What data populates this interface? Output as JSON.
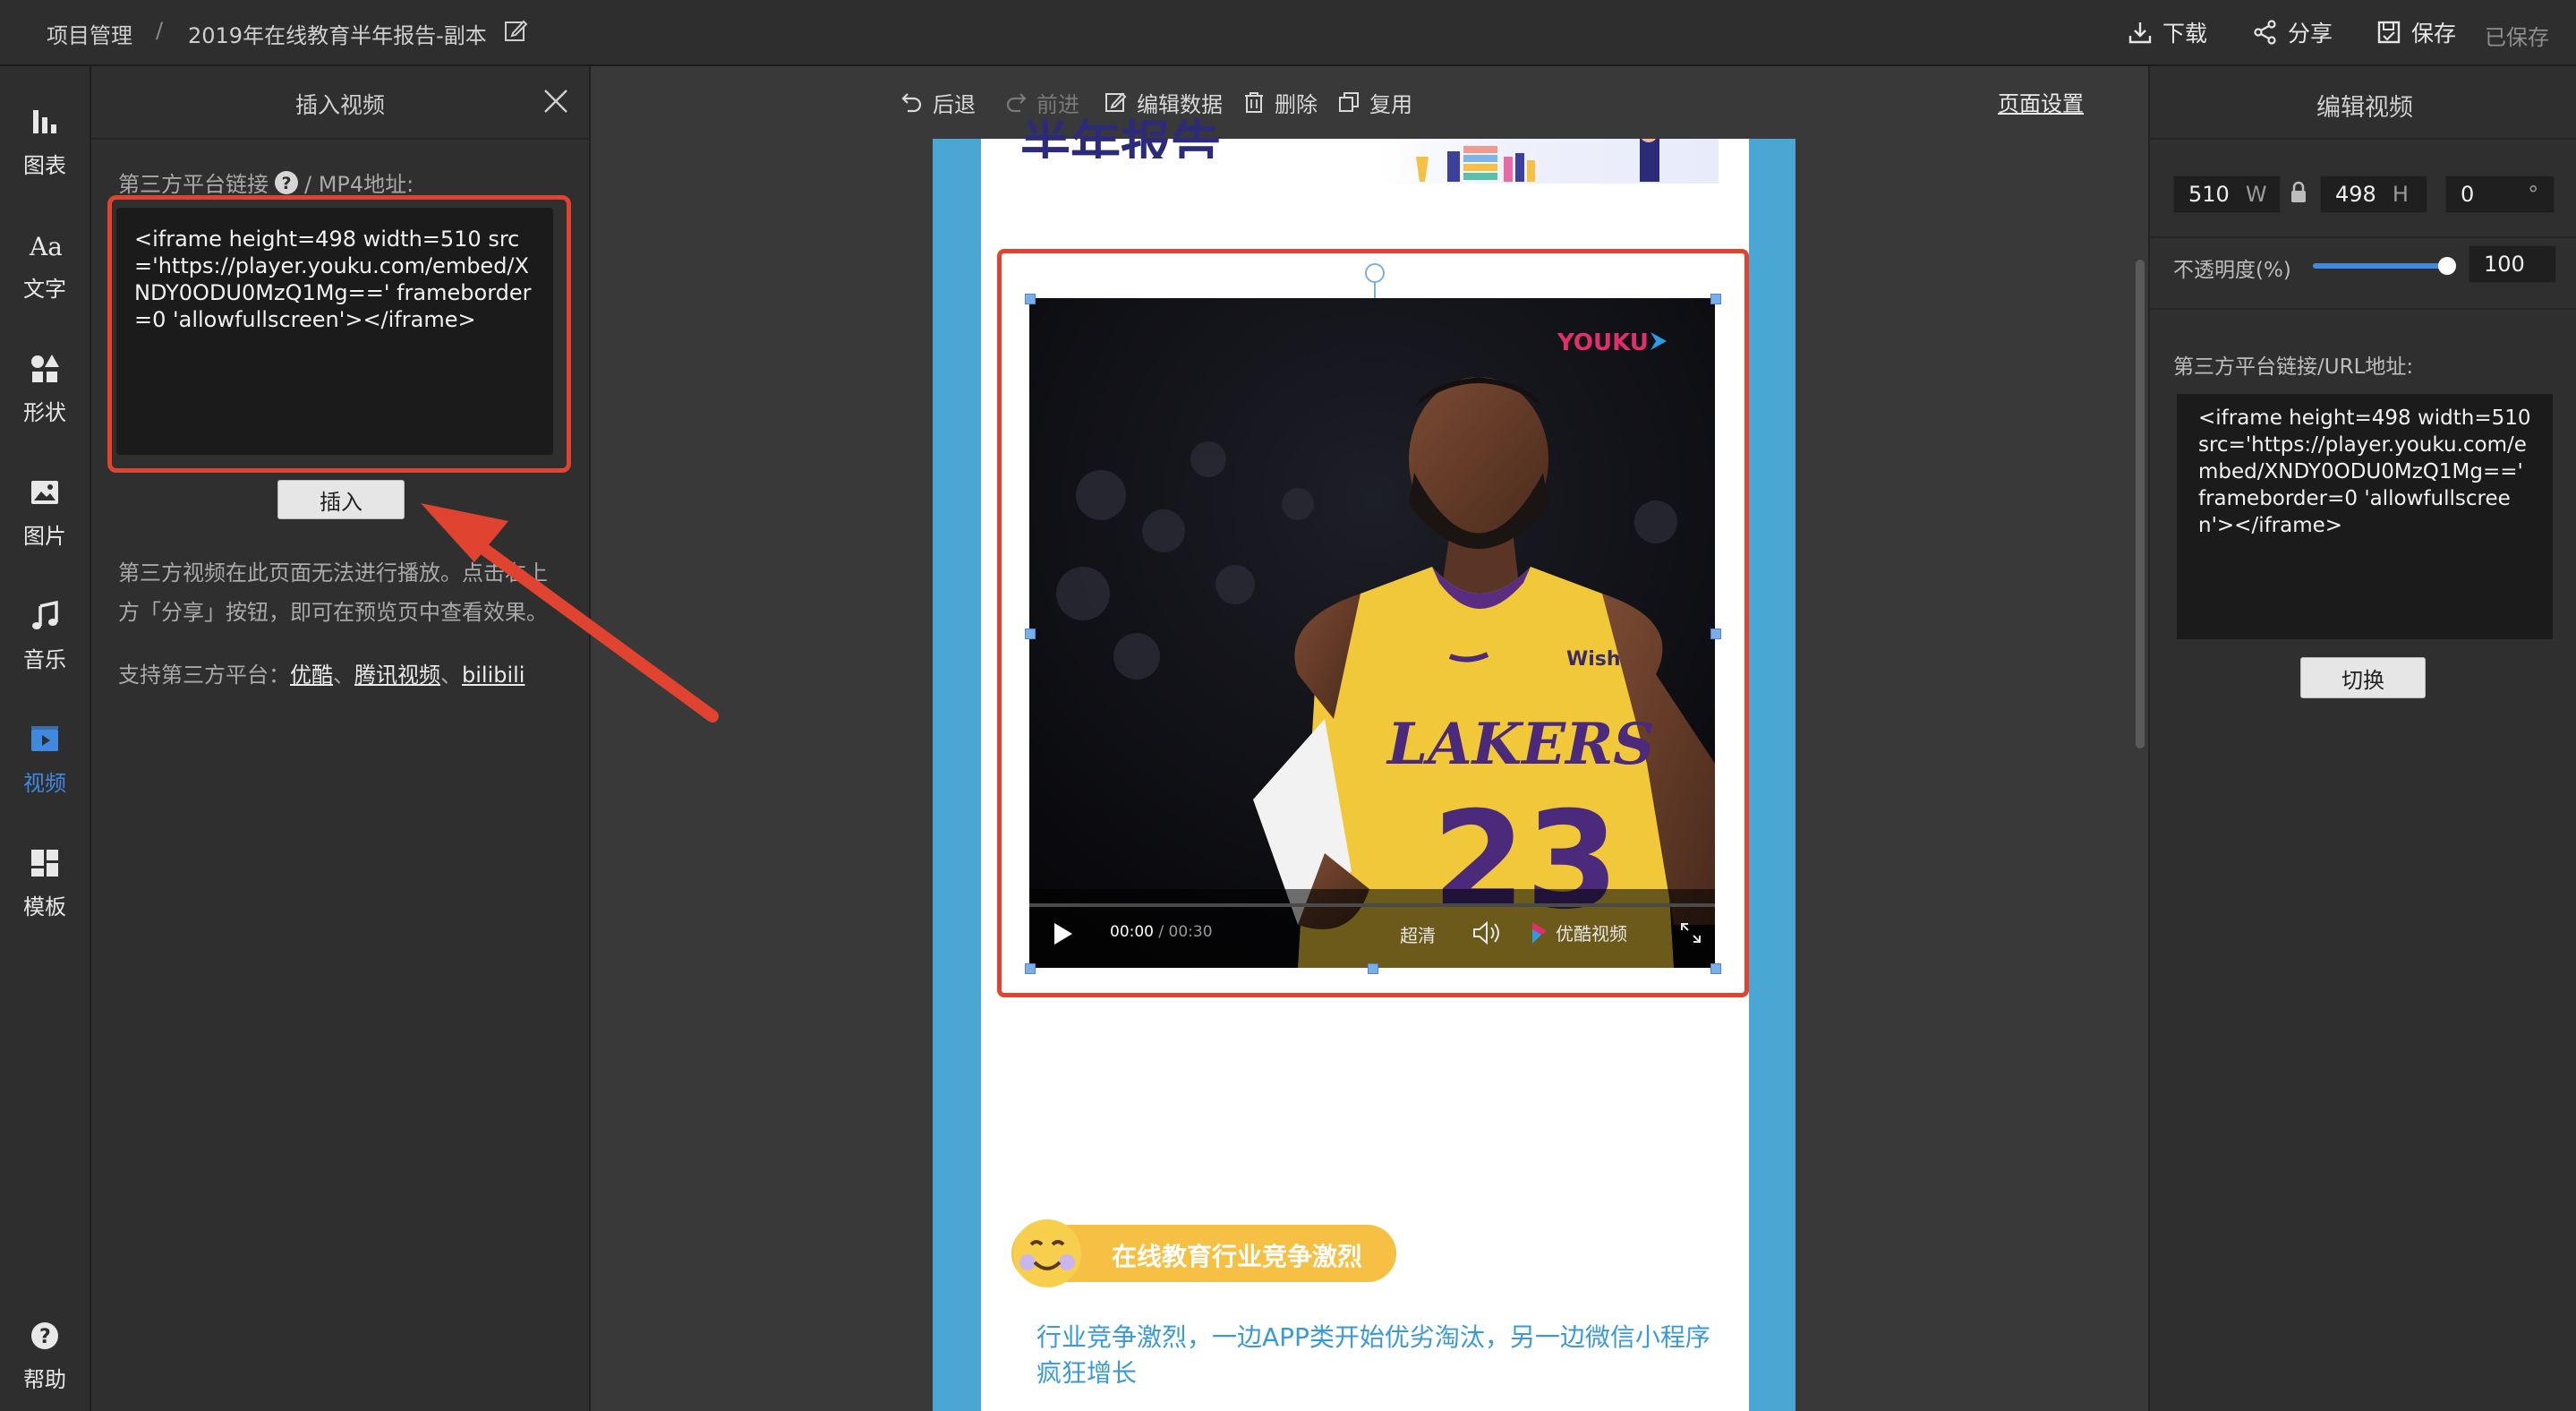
{
  "topbar": {
    "breadcrumb_root": "项目管理",
    "breadcrumb_sep": "/",
    "doc_title": "2019年在线教育半年报告-副本",
    "download_label": "下载",
    "share_label": "分享",
    "save_label": "保存",
    "saved_status": "已保存"
  },
  "rail": {
    "items": [
      {
        "label": "图表",
        "icon": "chart-icon"
      },
      {
        "label": "文字",
        "icon": "text-icon"
      },
      {
        "label": "形状",
        "icon": "shape-icon"
      },
      {
        "label": "图片",
        "icon": "image-icon"
      },
      {
        "label": "音乐",
        "icon": "music-icon"
      },
      {
        "label": "视频",
        "icon": "video-icon",
        "active": true
      },
      {
        "label": "模板",
        "icon": "template-icon"
      }
    ],
    "help_label": "帮助"
  },
  "insert_panel": {
    "title": "插入视频",
    "link_label_prefix": "第三方平台链接",
    "link_label_suffix": "/ MP4地址:",
    "code": "<iframe height=498 width=510 src='https://player.youku.com/embed/XNDY0ODU0MzQ1Mg==' frameborder=0 'allowfullscreen'></iframe>",
    "insert_button": "插入",
    "hint_line1": "第三方视频在此页面无法进行播放。点击右上",
    "hint_line2": "方「分享」按钮，即可在预览页中查看效果。",
    "platforms_label": "支持第三方平台：",
    "platforms": [
      "优酷",
      "腾讯视频",
      "bilibili"
    ],
    "platform_sep": "、"
  },
  "editor_toolbar": {
    "undo": "后退",
    "redo": "前进",
    "edit_data": "编辑数据",
    "delete": "删除",
    "duplicate": "复用",
    "page_settings": "页面设置"
  },
  "canvas": {
    "heading_fragment": "半年报告",
    "video": {
      "brand": "YOUKU",
      "jersey_team": "LAKERS",
      "jersey_number": "23",
      "jersey_sponsor": "Wish",
      "time_current": "00:00",
      "time_total": "/ 00:30",
      "quality": "超清",
      "player_brand": "优酷视频"
    },
    "section_title": "在线教育行业竞争激烈",
    "section_text_line1": "行业竞争激烈，一边APP类开始优劣淘汰，另一边微信小程序",
    "section_text_line2": "疯狂增长"
  },
  "right_panel": {
    "title": "编辑视频",
    "width_value": "510",
    "width_unit": "W",
    "height_value": "498",
    "height_unit": "H",
    "rotation_value": "0",
    "rotation_unit": "°",
    "opacity_label": "不透明度(%)",
    "opacity_value": "100",
    "opacity_fraction": 1.0,
    "url_label": "第三方平台链接/URL地址:",
    "url_value": "<iframe height=498 width=510 src='https://player.youku.com/embed/XNDY0ODU0MzQ1Mg==' frameborder=0 'allowfullscreen'></iframe>",
    "switch_button": "切换"
  },
  "colors": {
    "accent": "#3f8ae0",
    "highlight_red": "#e0432f",
    "page_border": "#4aa6d3",
    "section_text": "#3a9ad6",
    "badge_yellow": "#f5c043"
  }
}
